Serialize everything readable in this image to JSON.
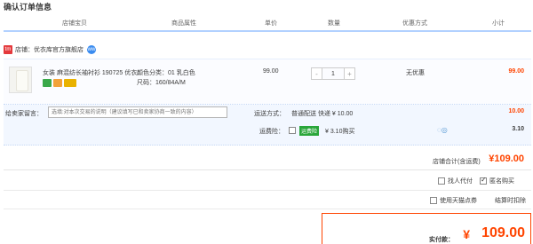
{
  "page_title": "确认订单信息",
  "columns": [
    "店铺宝贝",
    "商品属性",
    "单价",
    "数量",
    "优惠方式",
    "小计"
  ],
  "shop": {
    "logo_text": "tm",
    "label": "店铺：优衣库官方旗舰店",
    "ww_icon": "ww"
  },
  "item": {
    "title": "女装 麻混纺长袖衬衫 190725 优衣...",
    "sku_line1": "颜色分类：01 乳白色",
    "sku_line2": "尺码：160/84A/M",
    "price": "99.00",
    "qty_minus": "-",
    "qty_value": "1",
    "qty_plus": "+",
    "promo": "无优惠",
    "subtotal": "99.00"
  },
  "memo": {
    "label": "给卖家留言：",
    "placeholder": "选填:对本次交易的说明（建议填写已和卖家协商一致的内容）"
  },
  "shipping": {
    "label": "运送方式：",
    "value": "普通配送 快递 ¥ 10.00",
    "fee": "10.00"
  },
  "insurance": {
    "label": "运费险：",
    "tag": "运费险",
    "value": "¥ 3.10购买",
    "fee": "3.10"
  },
  "shop_total": {
    "label": "店铺合计(含运费)",
    "value": "¥109.00"
  },
  "options": {
    "proxy_pay": "找人代付",
    "anonymous": "匿名购买",
    "tmall_points": "使用天猫点券",
    "deduct_on_settle": "结算时扣除"
  },
  "final": {
    "label": "实付款：",
    "yen": "¥",
    "value": "109.00"
  },
  "colors": {
    "accent": "#ff4400",
    "header_rule": "#b2d1ff",
    "memo_bg": "#f2f7ff"
  }
}
